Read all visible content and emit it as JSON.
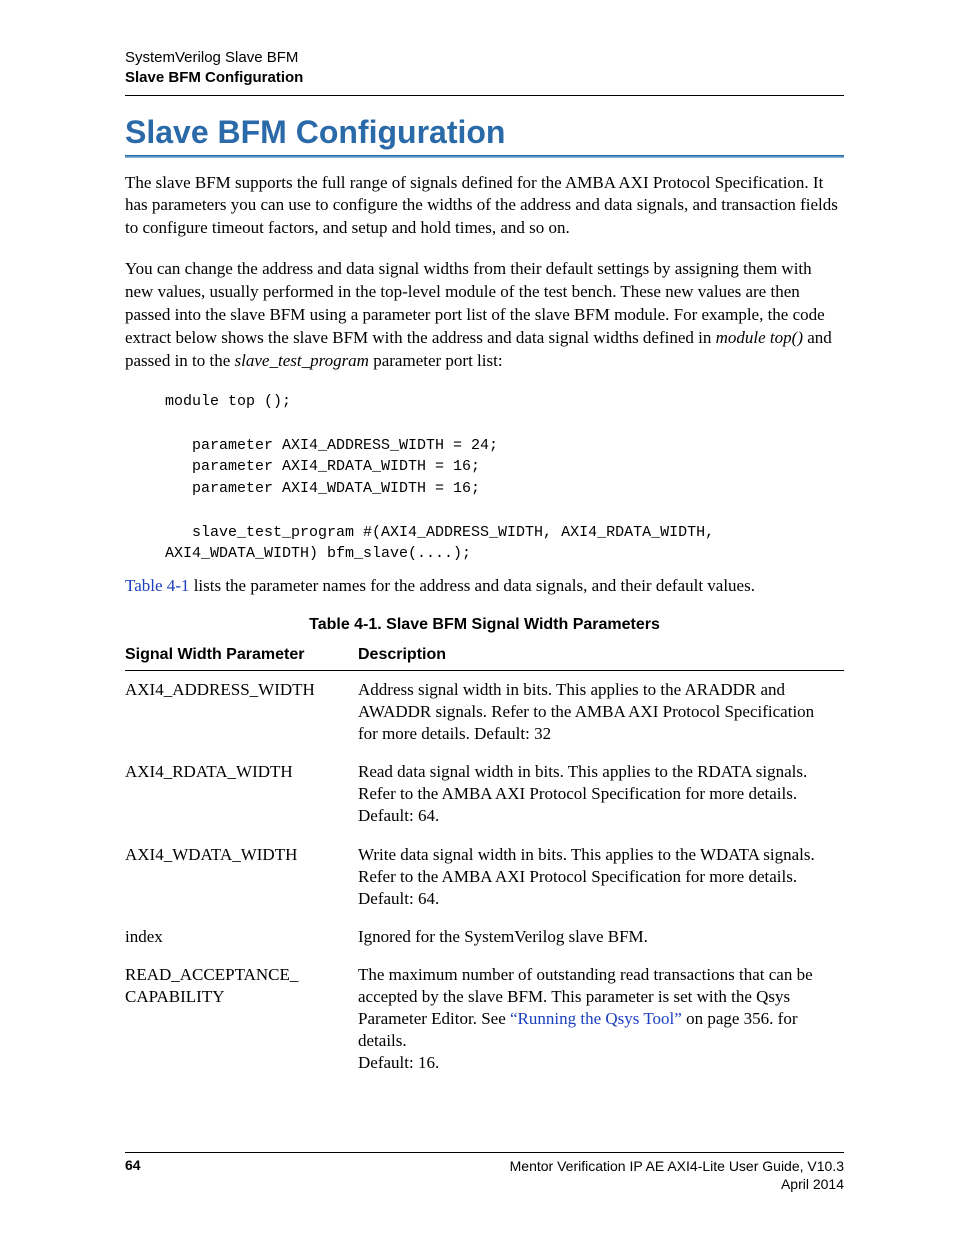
{
  "header": {
    "line1": "SystemVerilog Slave BFM",
    "line2": "Slave BFM Configuration"
  },
  "title": "Slave BFM Configuration",
  "para1": "The slave BFM supports the full range of signals defined for the AMBA AXI Protocol Specification. It has parameters you can use to configure the widths of the address and data signals, and transaction fields to configure timeout factors, and setup and hold times, and so on.",
  "para2_pre": "You can change the address and data signal widths from their default settings by assigning them with new values, usually performed in the top-level module of the test bench. These new values are then passed into the slave BFM using a parameter port list of the slave BFM module. For example, the code extract below shows the slave BFM with the address and data signal widths defined in ",
  "para2_ital1": "module top()",
  "para2_mid": " and passed in to the ",
  "para2_ital2": "slave_test_program",
  "para2_post": " parameter port list:",
  "code": "module top ();\n\n   parameter AXI4_ADDRESS_WIDTH = 24;\n   parameter AXI4_RDATA_WIDTH = 16;\n   parameter AXI4_WDATA_WIDTH = 16;\n\n   slave_test_program #(AXI4_ADDRESS_WIDTH, AXI4_RDATA_WIDTH,\nAXI4_WDATA_WIDTH) bfm_slave(....);",
  "ref_link": "Table 4-1",
  "ref_text": " lists the parameter names for the address and data signals, and their default values.",
  "table": {
    "caption": "Table 4-1. Slave BFM Signal Width Parameters",
    "col1": "Signal Width Parameter",
    "col2": "Description",
    "rows": [
      {
        "param": "AXI4_ADDRESS_WIDTH",
        "desc": "Address signal width in bits. This applies to the ARADDR and AWADDR signals. Refer to the AMBA AXI Protocol Specification for more details. Default: 32"
      },
      {
        "param": "AXI4_RDATA_WIDTH",
        "desc": "Read data signal width in bits. This applies to the RDATA signals. Refer to the AMBA AXI Protocol Specification for more details. Default: 64."
      },
      {
        "param": "AXI4_WDATA_WIDTH",
        "desc": "Write data signal width in bits. This applies to the WDATA signals. Refer to the AMBA AXI Protocol Specification for more details. Default: 64."
      },
      {
        "param": "index",
        "desc": "Ignored for the SystemVerilog slave BFM."
      },
      {
        "param": "READ_ACCEPTANCE_\nCAPABILITY",
        "desc_pre": "The maximum number of outstanding read transactions that can be accepted by the slave BFM. This parameter is set with the Qsys Parameter Editor. See ",
        "desc_link": "“Running the Qsys Tool”",
        "desc_post": " on page 356. for details.\nDefault: 16."
      }
    ]
  },
  "footer": {
    "page": "64",
    "right1": "Mentor Verification IP AE AXI4-Lite User Guide, V10.3",
    "right2": "April 2014"
  }
}
